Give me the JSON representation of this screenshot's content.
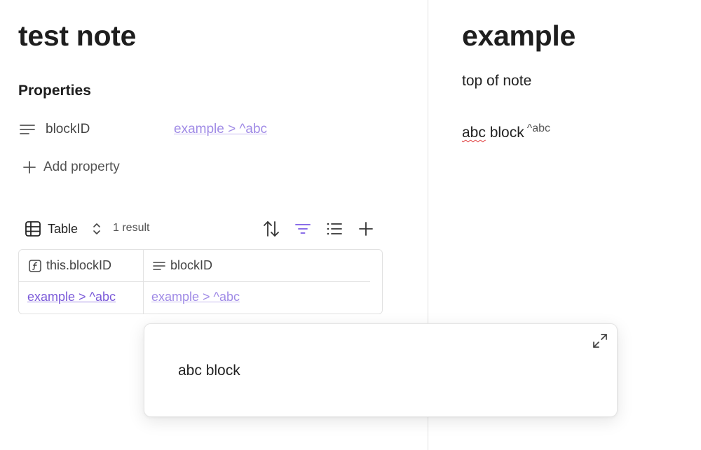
{
  "left_note": {
    "title": "test note",
    "properties_heading": "Properties",
    "property": {
      "key": "blockID",
      "value": "example > ^abc",
      "icon": "text-lines-icon"
    },
    "add_property_label": "Add property",
    "base": {
      "view_label": "Table",
      "result_count": "1 result",
      "toolbar_icons": [
        "sort-icon",
        "filter-icon",
        "list-properties-icon",
        "add-icon"
      ],
      "columns": [
        {
          "label": "this.blockID",
          "icon": "formula-icon"
        },
        {
          "label": "blockID",
          "icon": "text-lines-icon"
        }
      ],
      "rows": [
        [
          "example > ^abc",
          "example > ^abc"
        ]
      ]
    }
  },
  "right_note": {
    "title": "example",
    "para1": "top of note",
    "para2_misspelled": "abc",
    "para2_rest": " block",
    "block_id": "^abc"
  },
  "hover_preview": {
    "text": "abc block",
    "expand_icon": "expand-icon"
  },
  "colors": {
    "link": "#a08be6",
    "link_strong": "#7b5ad9",
    "accent_filter": "#8a6ee8",
    "spellcheck": "#e03e3e"
  }
}
